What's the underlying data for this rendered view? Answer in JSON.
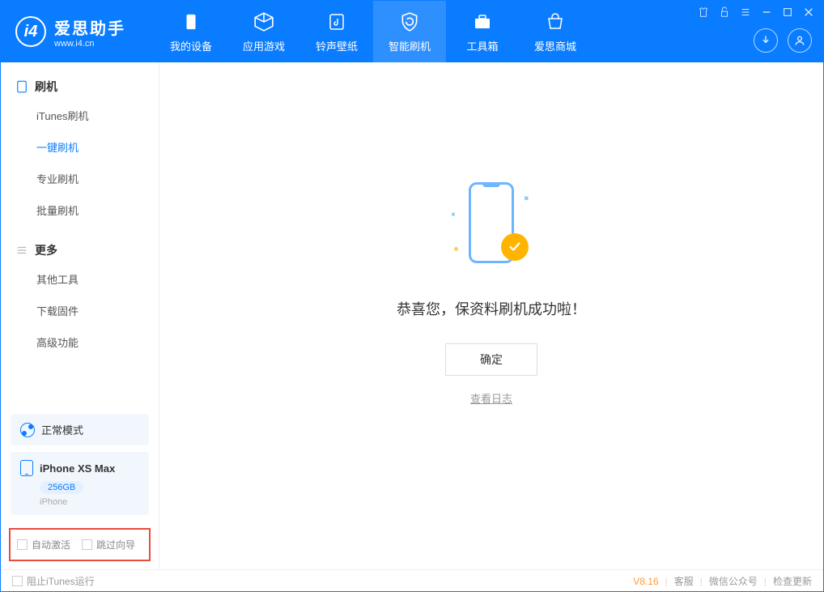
{
  "app": {
    "title": "爱思助手",
    "subtitle": "www.i4.cn"
  },
  "nav": [
    {
      "label": "我的设备"
    },
    {
      "label": "应用游戏"
    },
    {
      "label": "铃声壁纸"
    },
    {
      "label": "智能刷机",
      "active": true
    },
    {
      "label": "工具箱"
    },
    {
      "label": "爱思商城"
    }
  ],
  "sidebar": {
    "section1": {
      "title": "刷机",
      "items": [
        "iTunes刷机",
        "一键刷机",
        "专业刷机",
        "批量刷机"
      ],
      "activeIndex": 1
    },
    "section2": {
      "title": "更多",
      "items": [
        "其他工具",
        "下载固件",
        "高级功能"
      ]
    }
  },
  "mode": {
    "label": "正常模式"
  },
  "device": {
    "name": "iPhone XS Max",
    "capacity": "256GB",
    "type": "iPhone"
  },
  "checkboxes": {
    "auto_activate": "自动激活",
    "skip_guide": "跳过向导"
  },
  "main": {
    "success_message": "恭喜您，保资料刷机成功啦！",
    "ok_button": "确定",
    "view_log": "查看日志"
  },
  "footer": {
    "block_itunes": "阻止iTunes运行",
    "version": "V8.16",
    "links": [
      "客服",
      "微信公众号",
      "检查更新"
    ]
  }
}
